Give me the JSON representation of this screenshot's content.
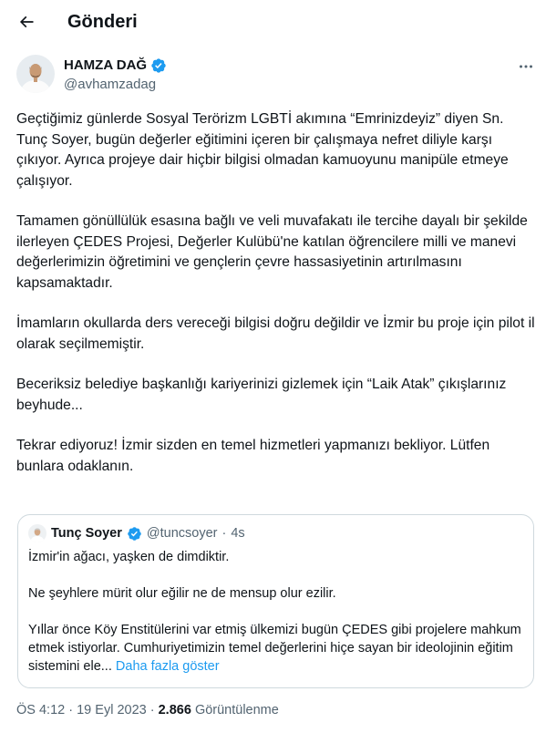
{
  "header": {
    "title": "Gönderi"
  },
  "author": {
    "name": "HAMZA DAĞ",
    "handle": "@avhamzadag"
  },
  "tweet": {
    "paragraphs": [
      "Geçtiğimiz günlerde Sosyal Terörizm LGBTİ akımına “Emrinizdeyiz” diyen Sn. Tunç Soyer, bugün değerler eğitimini içeren bir çalışmaya nefret diliyle karşı çıkıyor. Ayrıca projeye dair hiçbir bilgisi olmadan kamuoyunu manipüle etmeye çalışıyor.",
      "Tamamen gönüllülük esasına bağlı ve veli muvafakatı ile tercihe dayalı bir şekilde ilerleyen ÇEDES Projesi, Değerler Kulübü'ne katılan öğrencilere milli ve manevi değerlerimizin öğretimini ve gençlerin çevre hassasiyetinin artırılmasını kapsamaktadır.",
      "İmamların okullarda ders vereceği bilgisi doğru değildir ve İzmir bu proje için pilot il olarak seçilmemiştir.",
      "Beceriksiz belediye başkanlığı kariyerinizi gizlemek için “Laik Atak” çıkışlarınız beyhude...",
      "Tekrar ediyoruz! İzmir sizden en temel hizmetleri yapmanızı bekliyor. Lütfen bunlara odaklanın."
    ]
  },
  "quote": {
    "name": "Tunç Soyer",
    "handle": "@tuncsoyer",
    "dot": "·",
    "time": "4s",
    "paragraphs": [
      "İzmir'in ağacı, yaşken de dimdiktir.",
      "Ne şeyhlere mürit olur eğilir ne de mensup olur ezilir.",
      "Yıllar önce Köy Enstitülerini var etmiş ülkemizi bugün ÇEDES gibi projelere mahkum etmek istiyorlar. Cumhuriyetimizin temel değerlerini hiçe sayan bir ideolojinin eğitim sistemini ele..."
    ],
    "show_more": "Daha fazla göster"
  },
  "meta": {
    "time": "ÖS 4:12",
    "sep": "·",
    "date": "19 Eyl 2023",
    "views_count": "2.866",
    "views_label": "Görüntülenme"
  },
  "colors": {
    "accent": "#1d9bf0",
    "text": "#0f1419",
    "muted": "#536471",
    "border": "#cfd9de"
  }
}
